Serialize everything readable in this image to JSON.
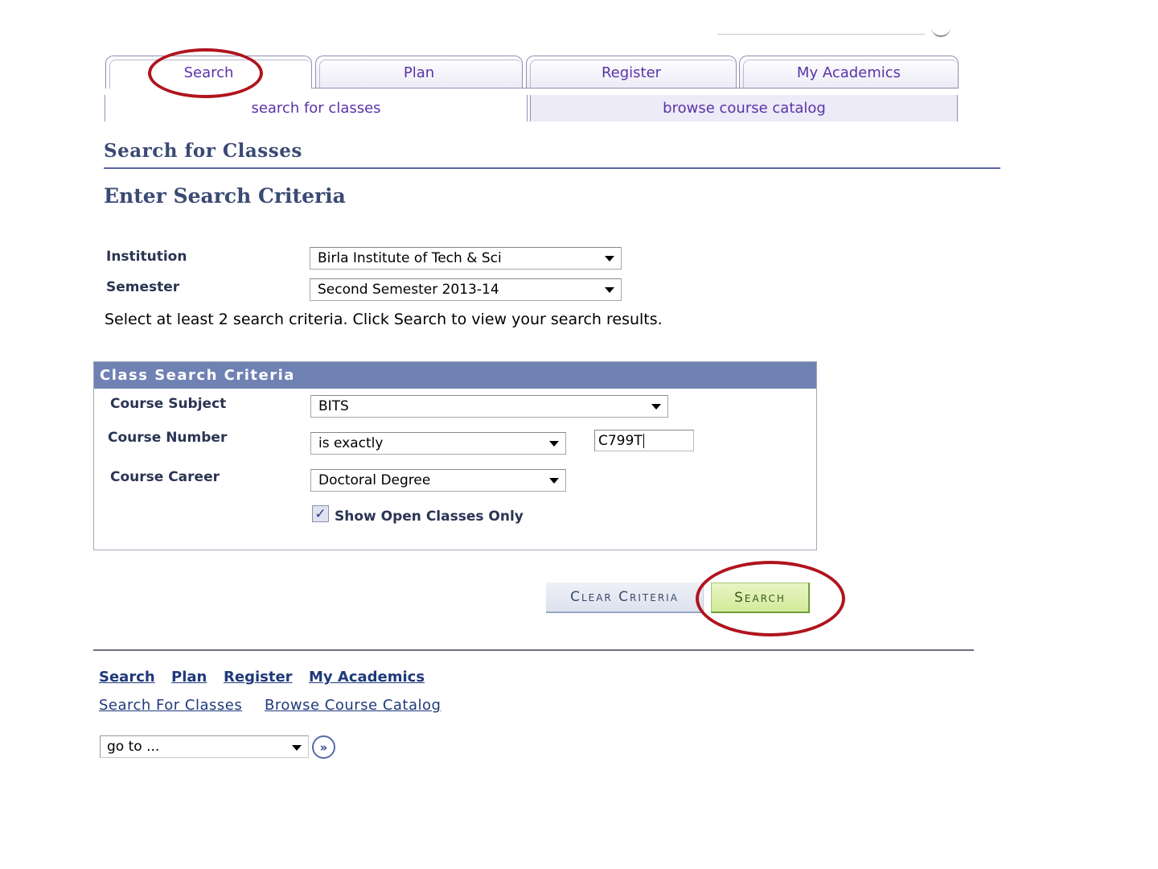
{
  "tabs": [
    {
      "label": "Search",
      "active": true
    },
    {
      "label": "Plan"
    },
    {
      "label": "Register"
    },
    {
      "label": "My Academics"
    }
  ],
  "subtabs": [
    {
      "label": "search for classes",
      "active": true
    },
    {
      "label": "browse course catalog"
    }
  ],
  "page_title": "Search for Classes",
  "section_title": "Enter Search Criteria",
  "institution": {
    "label": "Institution",
    "value": "Birla Institute of Tech & Sci"
  },
  "semester": {
    "label": "Semester",
    "value": "Second Semester 2013-14"
  },
  "note": "Select at least 2 search criteria. Click Search to view your search results.",
  "criteria": {
    "header": "Class Search Criteria",
    "course_subject": {
      "label": "Course Subject",
      "value": "BITS"
    },
    "course_number": {
      "label": "Course Number",
      "operator": "is exactly",
      "value": "C799T"
    },
    "course_career": {
      "label": "Course Career",
      "value": "Doctoral Degree"
    },
    "open_only": {
      "label": "Show Open Classes Only",
      "checked": true
    }
  },
  "buttons": {
    "clear": "Clear Criteria",
    "search": "Search"
  },
  "footer": {
    "links": [
      "Search",
      "Plan",
      "Register",
      "My Academics"
    ],
    "sublinks": [
      "Search For Classes",
      "Browse Course Catalog"
    ],
    "goto": "go to ...",
    "goto_icon": "double-chevron-right-icon"
  },
  "colors": {
    "accent": "#5a33a8",
    "header_bar": "#7082b4",
    "highlight_ring": "#b0141d",
    "search_button": "#d2eb9a"
  }
}
